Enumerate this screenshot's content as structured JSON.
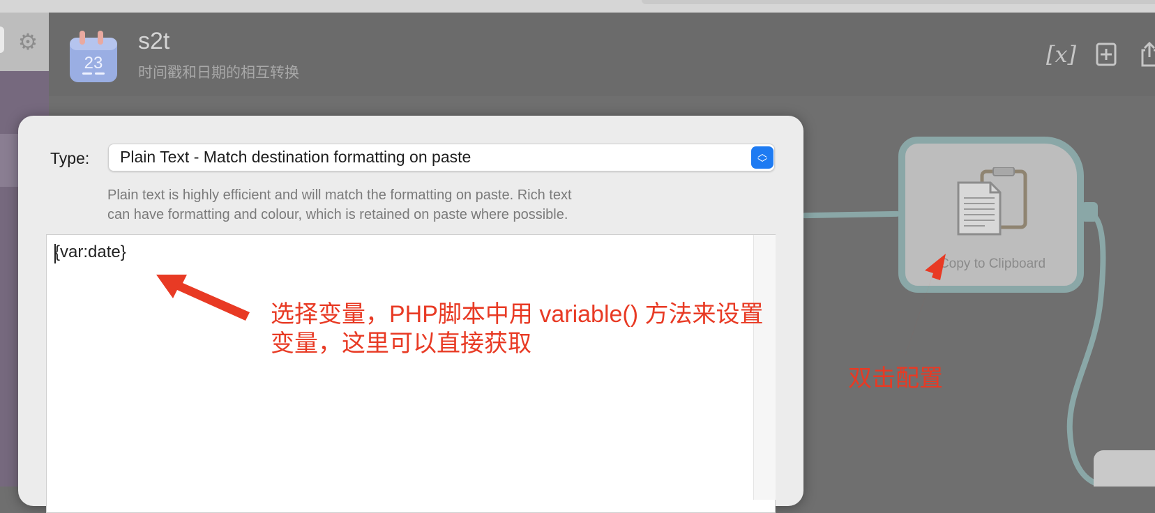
{
  "window": {
    "title": "s2t",
    "subtitle": "时间戳和日期的相互转换"
  },
  "app_icon": {
    "day": "23",
    "icon": "calendar-icon"
  },
  "toolbar": {
    "icons": [
      "variable-icon",
      "add-icon",
      "share-icon"
    ],
    "variable_glyph": "[x]"
  },
  "dialog": {
    "type_label": "Type:",
    "type_value": "Plain Text - Match destination formatting on paste",
    "help_line1": "Plain text is highly efficient and will match the formatting on paste. Rich text",
    "help_line2": "can have formatting and colour, which is retained on paste where possible.",
    "editor_text": "{var:date}"
  },
  "canvas": {
    "node_label": "Copy to Clipboard",
    "node_icon": "clipboard-icon"
  },
  "annotations": {
    "note1_line1": "选择变量，PHP脚本中用 variable() 方法来设置",
    "note1_line2": "变量，这里可以直接获取",
    "note2": "双击配置",
    "color": "#e83a24"
  },
  "colors": {
    "accent": "#1e7bf2",
    "connector": "#8aa7a7"
  }
}
